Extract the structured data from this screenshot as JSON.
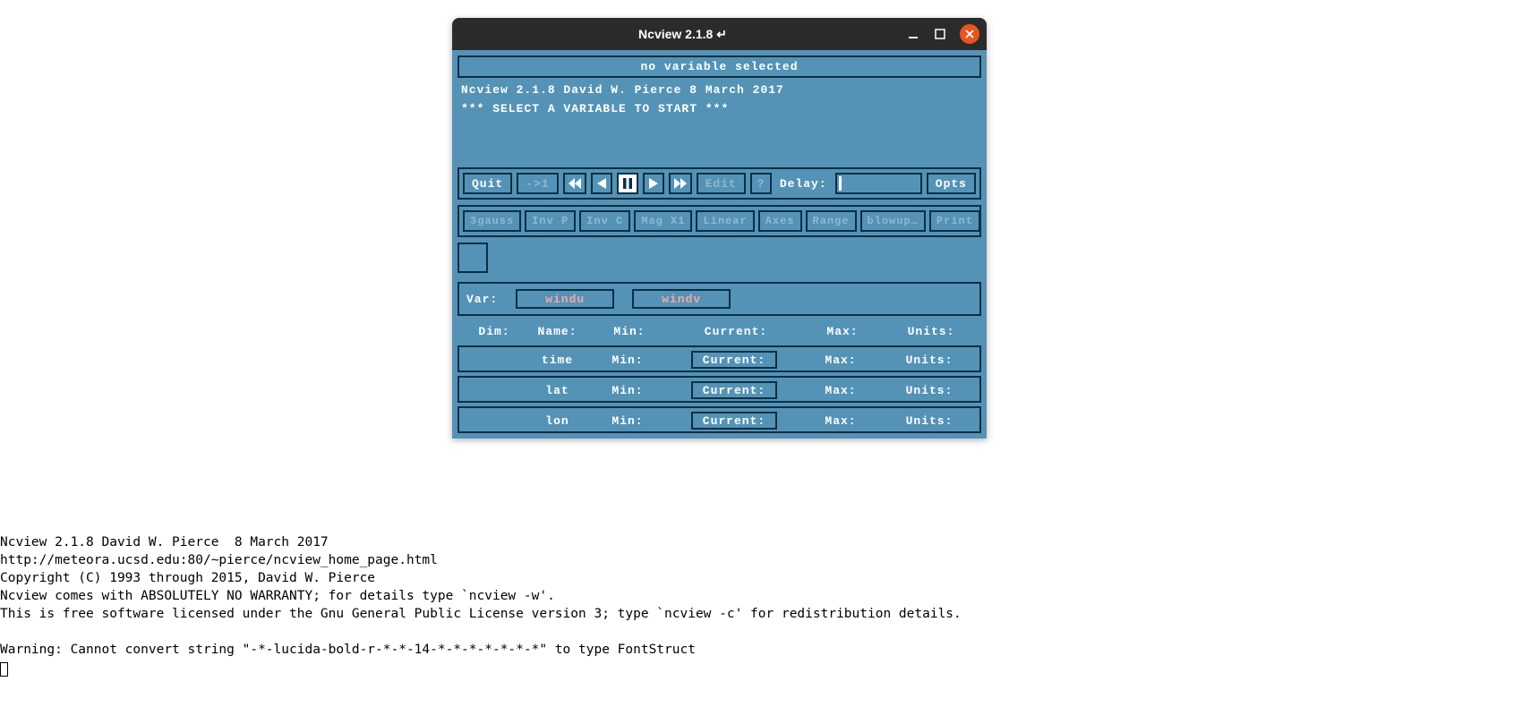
{
  "window": {
    "title": "Ncview 2.1.8 ↵"
  },
  "status": "no variable selected",
  "info": {
    "line1": "Ncview 2.1.8 David W. Pierce  8 March 2017",
    "line2": "*** SELECT A VARIABLE TO START ***"
  },
  "toolbar1": {
    "quit": "Quit",
    "arrow1": "->1",
    "edit": "Edit",
    "qmark": "?",
    "delay_label": "Delay:",
    "opts": "Opts"
  },
  "toolbar2": {
    "b0": "3gauss",
    "b1": "Inv P",
    "b2": "Inv C",
    "b3": "Mag X1",
    "b4": "Linear",
    "b5": "Axes",
    "b6": "Range",
    "b7": "blowup…",
    "b8": "Print"
  },
  "var": {
    "label": "Var:",
    "v0": "windu",
    "v1": "windv"
  },
  "dimheader": {
    "dim": "Dim:",
    "name": "Name:",
    "min": "Min:",
    "current": "Current:",
    "max": "Max:",
    "units": "Units:"
  },
  "dimrows": [
    {
      "name": "time",
      "min": "Min:",
      "current": "Current:",
      "max": "Max:",
      "units": "Units:"
    },
    {
      "name": "lat",
      "min": "Min:",
      "current": "Current:",
      "max": "Max:",
      "units": "Units:"
    },
    {
      "name": "lon",
      "min": "Min:",
      "current": "Current:",
      "max": "Max:",
      "units": "Units:"
    }
  ],
  "terminal": {
    "l0": "Ncview 2.1.8 David W. Pierce  8 March 2017",
    "l1": "http://meteora.ucsd.edu:80/~pierce/ncview_home_page.html",
    "l2": "Copyright (C) 1993 through 2015, David W. Pierce",
    "l3": "Ncview comes with ABSOLUTELY NO WARRANTY; for details type `ncview -w'.",
    "l4": "This is free software licensed under the Gnu General Public License version 3; type `ncview -c' for redistribution details.",
    "l5": "",
    "l6": "Warning: Cannot convert string \"-*-lucida-bold-r-*-*-14-*-*-*-*-*-*-*\" to type FontStruct"
  }
}
